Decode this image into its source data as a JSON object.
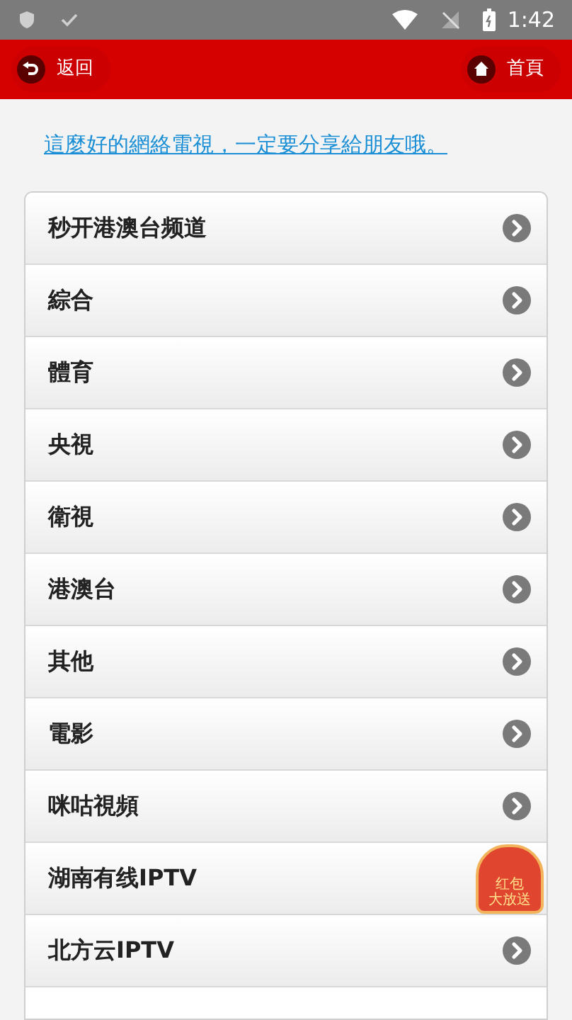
{
  "status_bar": {
    "time": "1:42"
  },
  "header": {
    "back": "返回",
    "home": "首頁"
  },
  "share_link": "這麼好的網絡電視，一定要分享給朋友哦。",
  "channels": [
    {
      "label": "秒开港澳台频道"
    },
    {
      "label": "綜合"
    },
    {
      "label": "體育"
    },
    {
      "label": "央視"
    },
    {
      "label": "衛視"
    },
    {
      "label": "港澳台"
    },
    {
      "label": "其他"
    },
    {
      "label": "電影"
    },
    {
      "label": "咪咕視頻"
    },
    {
      "label": "湖南有线IPTV",
      "kind": "promo"
    },
    {
      "label": "北方云IPTV"
    }
  ],
  "red_packet": {
    "line_1": "红包",
    "line_2": "大放送"
  }
}
